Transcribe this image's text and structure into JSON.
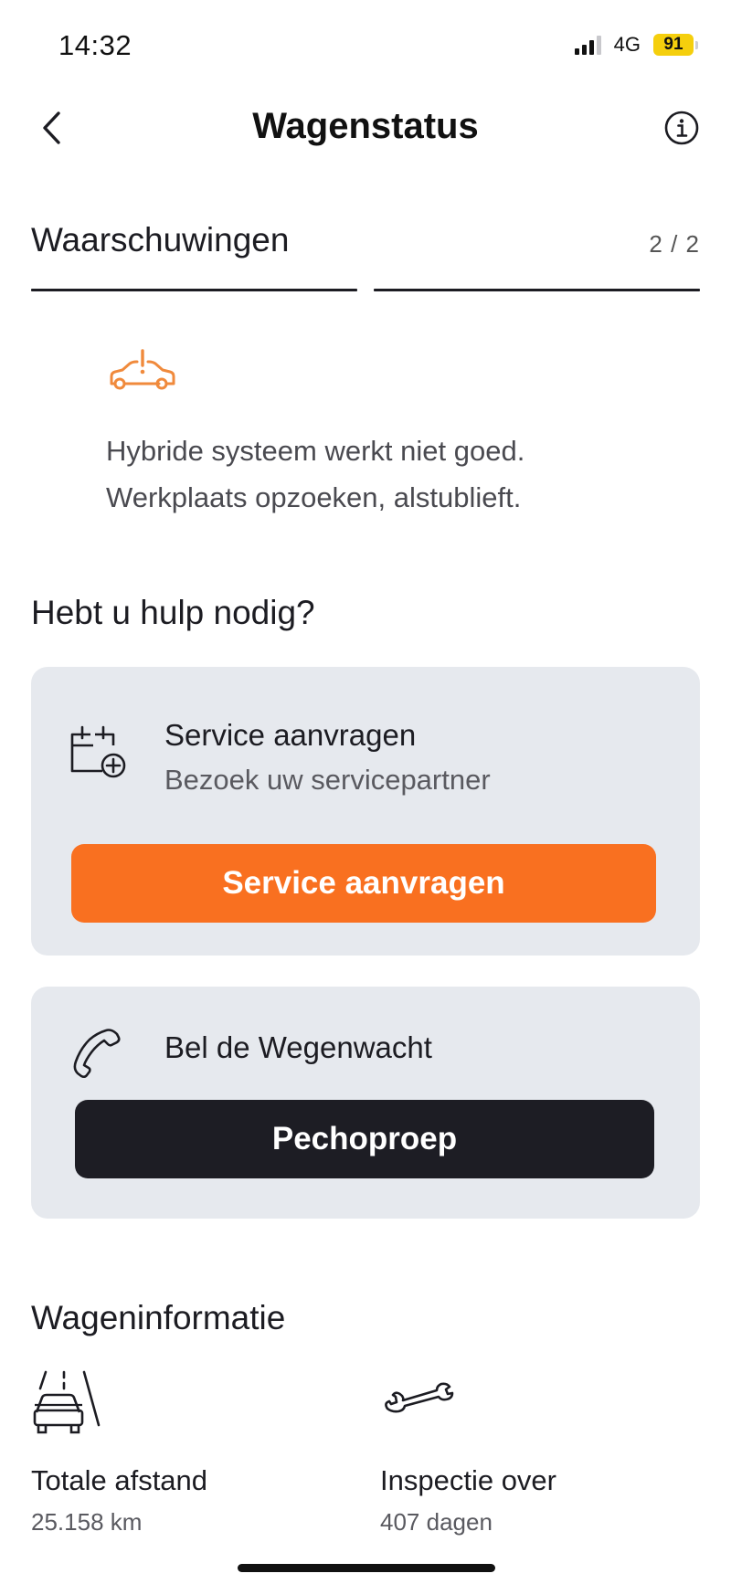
{
  "status_bar": {
    "time": "14:32",
    "network": "4G",
    "battery": "91",
    "battery_color": "#f5cf0d"
  },
  "nav": {
    "title": "Wagenstatus",
    "back_icon": "chevron-left-icon",
    "info_icon": "info-circle-icon"
  },
  "warnings": {
    "title": "Waarschuwingen",
    "counter": "2 / 2",
    "icon": "car-warning-icon",
    "icon_color": "#f08a3c",
    "message_line1": "Hybride systeem werkt niet goed.",
    "message_line2": "Werkplaats opzoeken, alstublieft."
  },
  "help": {
    "title": "Hebt u hulp nodig?",
    "service": {
      "icon": "calendar-add-icon",
      "title": "Service aanvragen",
      "subtitle": "Bezoek uw servicepartner",
      "button_label": "Service aanvragen",
      "button_color": "#f97020"
    },
    "call": {
      "icon": "phone-icon",
      "title": "Bel de Wegenwacht",
      "button_label": "Pechoproep",
      "button_color": "#1d1d24"
    }
  },
  "vehicle_info": {
    "title": "Wageninformatie",
    "items": [
      {
        "icon": "car-road-icon",
        "label": "Totale afstand",
        "value": "25.158 km"
      },
      {
        "icon": "wrench-icon",
        "label": "Inspectie over",
        "value": "407 dagen"
      }
    ]
  }
}
